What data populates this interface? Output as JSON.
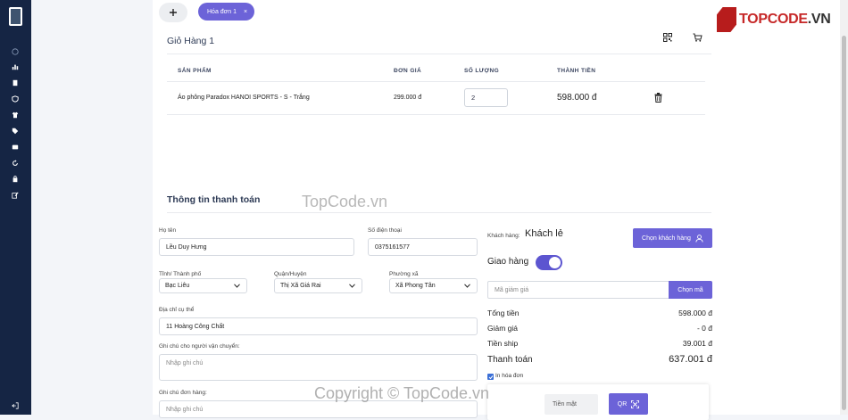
{
  "tabs": {
    "add_label": "+",
    "active_tab": "Hóa đơn 1",
    "close": "×"
  },
  "cart": {
    "title": "Giỏ Hàng 1",
    "columns": [
      "SẢN PHẨM",
      "ĐƠN GIÁ",
      "SỐ LƯỢNG",
      "THÀNH TIỀN"
    ],
    "items": [
      {
        "product": "Áo phông Paradox HANOI SPORTS - S - Trắng",
        "price": "299.000 đ",
        "qty": "2",
        "total": "598.000 đ"
      }
    ]
  },
  "payment": {
    "title": "Thông tin thanh toán",
    "name_label": "Họ tên",
    "name_value": "Lều Duy Hưng",
    "phone_label": "Số điện thoại",
    "phone_value": "0375161577",
    "province_label": "Tỉnh/ Thành phố",
    "province_value": "Bạc Liêu",
    "district_label": "Quận/Huyện",
    "district_value": "Thị Xã Giá Rai",
    "ward_label": "Phường xã",
    "ward_value": "Xã Phong Tân",
    "address_label": "Địa chỉ cụ thể",
    "address_value": "11 Hoàng Công Chất",
    "ship_note_label": "Ghi chú cho người vận chuyển:",
    "ship_note_placeholder": "Nhập ghi chú",
    "order_note_label": "Ghi chú đơn hàng:",
    "order_note_placeholder": "Nhập ghi chú"
  },
  "summary": {
    "customer_label": "Khách hàng:",
    "customer_value": "Khách lẻ",
    "choose_customer": "Chọn khách hàng",
    "delivery_label": "Giao hàng",
    "delivery_on": true,
    "coupon_placeholder": "Mã giảm giá",
    "coupon_button": "Chọn mã",
    "total_label": "Tổng tiền",
    "total_value": "598.000 đ",
    "discount_label": "Giảm giá",
    "discount_value": "- 0 đ",
    "shipping_label": "Tiền ship",
    "shipping_value": "39.001 đ",
    "pay_label": "Thanh toán",
    "pay_value": "637.001 đ",
    "print_label": "In hóa đơn",
    "cash_label": "Tiền mặt",
    "qr_label": "QR"
  },
  "watermark": {
    "brand_a": "TOPCODE",
    "brand_b": ".VN",
    "mid": "TopCode.vn",
    "copy": "Copyright © TopCode.vn"
  },
  "colors": {
    "accent": "#6c63d8",
    "sidebar": "#152544"
  }
}
